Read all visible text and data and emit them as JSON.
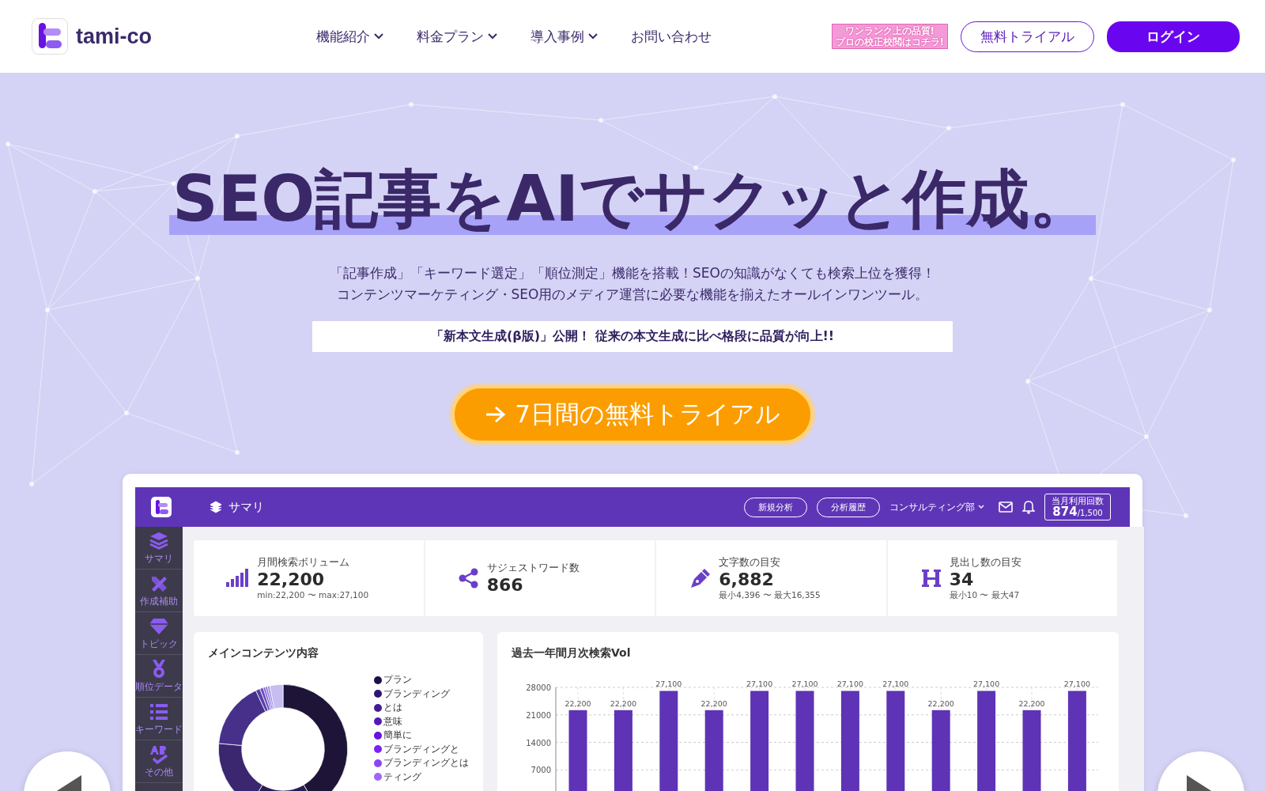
{
  "header": {
    "brand": "tami-co",
    "nav": [
      {
        "label": "機能紹介",
        "has_menu": true
      },
      {
        "label": "料金プラン",
        "has_menu": true
      },
      {
        "label": "導入事例",
        "has_menu": true
      },
      {
        "label": "お問い合わせ",
        "has_menu": false
      }
    ],
    "promo_banner": [
      "ワンランク上の品質!",
      "プロの校正校閲はコチラ!"
    ],
    "trial_button": "無料トライアル",
    "login_button": "ログイン"
  },
  "hero": {
    "title": "SEO記事をAIでサクッと作成。",
    "description": [
      "「記事作成」「キーワード選定」「順位測定」機能を搭載！SEOの知識がなくても検索上位を獲得！",
      "コンテンツマーケティング・SEO用のメディア運営に必要な機能を揃えたオールインワンツール。"
    ],
    "notice": "「新本文生成(β版)」公開！ 従来の本文生成に比べ格段に品質が向上!!",
    "cta": "7日間の無料トライアル"
  },
  "dashboard": {
    "page_title": "サマリ",
    "buttons": [
      "新規分析",
      "分析履歴"
    ],
    "team": "コンサルティング部",
    "usage": {
      "label": "当月利用回数",
      "count": "874",
      "limit": "/1,500"
    },
    "sidebar": [
      {
        "label": "サマリ"
      },
      {
        "label": "作成補助"
      },
      {
        "label": "トピック"
      },
      {
        "label": "順位データ"
      },
      {
        "label": "キーワード"
      },
      {
        "label": "その他"
      }
    ],
    "stats": [
      {
        "label": "月間検索ボリューム",
        "value": "22,200",
        "sub": "min:22,200 〜 max:27,100"
      },
      {
        "label": "サジェストワード数",
        "value": "866"
      },
      {
        "label": "文字数の目安",
        "value": "6,882",
        "sub": "最小4,396 〜 最大16,355"
      },
      {
        "label": "見出し数の目安",
        "value": "34",
        "sub": "最小10 〜 最大47"
      }
    ],
    "content_panel": {
      "title": "メインコンテンツ内容",
      "legend": [
        {
          "label": "プラン",
          "color": "#1e0e4a"
        },
        {
          "label": "ブランディング",
          "color": "#2f1570"
        },
        {
          "label": "とは",
          "color": "#421c94"
        },
        {
          "label": "意味",
          "color": "#5518b8"
        },
        {
          "label": "簡単に",
          "color": "#6a12e0"
        },
        {
          "label": "ブランディングと",
          "color": "#7a22f5"
        },
        {
          "label": "ブランディングとは",
          "color": "#8f45f7"
        },
        {
          "label": "ティング",
          "color": "#a066f8"
        }
      ]
    },
    "volume_panel": {
      "title": "過去一年間月次検索Vol",
      "chart_data": {
        "type": "bar",
        "values": [
          22200,
          22200,
          27100,
          22200,
          27100,
          27100,
          27100,
          27100,
          22200,
          27100,
          22200,
          27100
        ],
        "yticks": [
          7000,
          14000,
          21000,
          28000
        ],
        "ylim": [
          0,
          28000
        ],
        "grid": true,
        "value_labels": [
          "22,200",
          "22,200",
          "27,100",
          "22,200",
          "27,100",
          "27,100",
          "27,100",
          "27,100",
          "22,200",
          "27,100",
          "22,200",
          "27,100"
        ]
      }
    }
  }
}
